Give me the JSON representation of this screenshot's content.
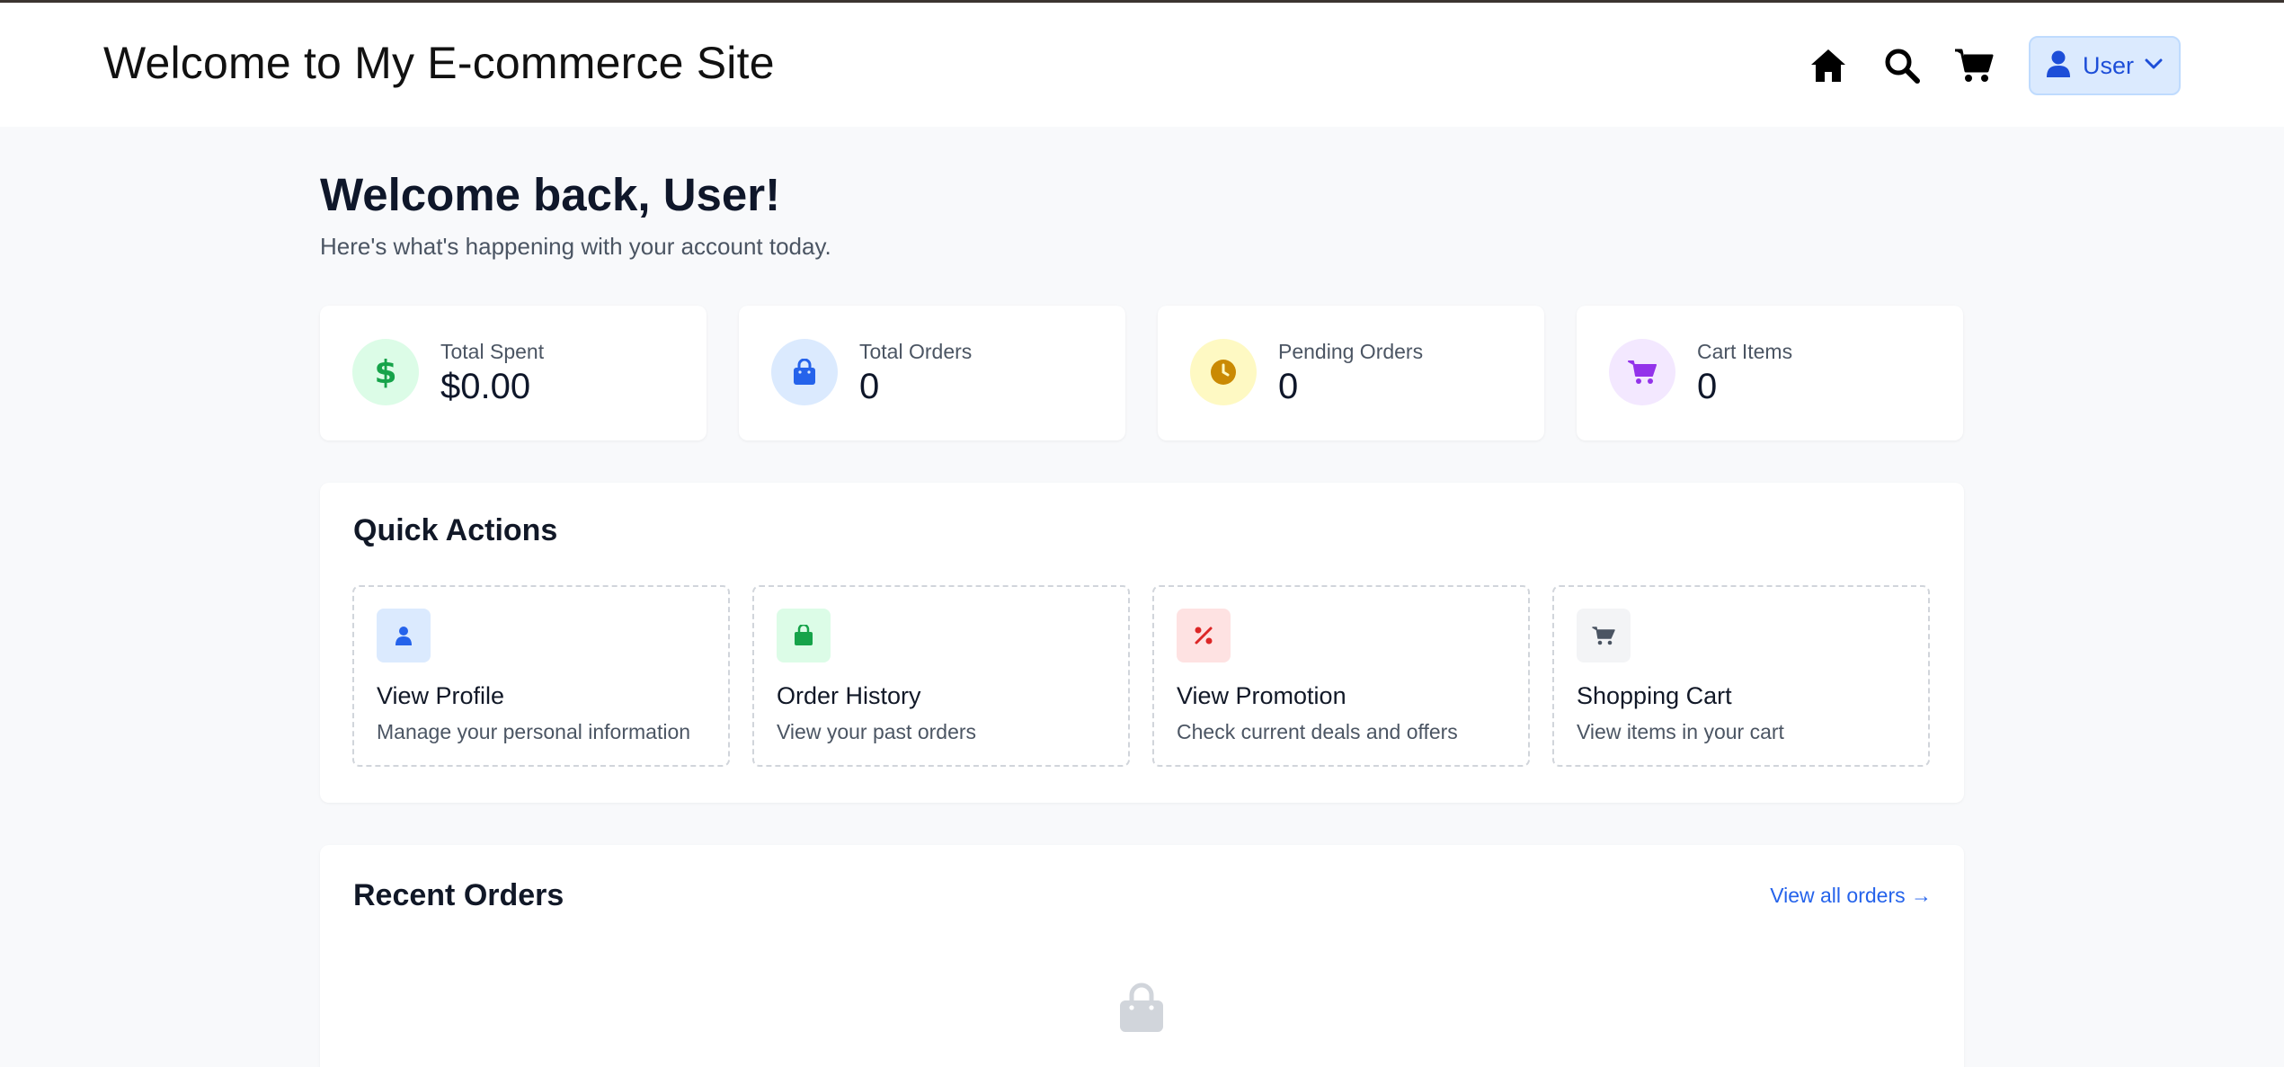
{
  "header": {
    "site_title": "Welcome to My E-commerce Site",
    "nav_icons": [
      "home-icon",
      "search-icon",
      "cart-icon"
    ],
    "user_menu": {
      "label": "User",
      "icons": [
        "user-icon",
        "chevron-down-icon"
      ]
    }
  },
  "dashboard": {
    "greeting": "Welcome back, User!",
    "subtitle": "Here's what's happening with your account today."
  },
  "stats": [
    {
      "label": "Total Spent",
      "value": "$0.00",
      "icon": "dollar-icon",
      "icon_bg": "#dcfce7",
      "icon_color": "#16a34a"
    },
    {
      "label": "Total Orders",
      "value": "0",
      "icon": "shopping-bag-icon",
      "icon_bg": "#dbeafe",
      "icon_color": "#2563eb"
    },
    {
      "label": "Pending Orders",
      "value": "0",
      "icon": "clock-icon",
      "icon_bg": "#fef9c3",
      "icon_color": "#ca8a04"
    },
    {
      "label": "Cart Items",
      "value": "0",
      "icon": "cart-icon",
      "icon_bg": "#f3e8ff",
      "icon_color": "#9333ea"
    }
  ],
  "quick_actions": {
    "title": "Quick Actions",
    "items": [
      {
        "title": "View Profile",
        "description": "Manage your personal information",
        "icon": "user-icon",
        "icon_bg": "#dbeafe",
        "icon_color": "#2563eb"
      },
      {
        "title": "Order History",
        "description": "View your past orders",
        "icon": "shopping-bag-icon",
        "icon_bg": "#dcfce7",
        "icon_color": "#16a34a"
      },
      {
        "title": "View Promotion",
        "description": "Check current deals and offers",
        "icon": "percent-icon",
        "icon_bg": "#fee2e2",
        "icon_color": "#dc2626"
      },
      {
        "title": "Shopping Cart",
        "description": "View items in your cart",
        "icon": "cart-icon",
        "icon_bg": "#f3f4f6",
        "icon_color": "#4b5563"
      }
    ]
  },
  "recent_orders": {
    "title": "Recent Orders",
    "view_all_label": "View all orders →",
    "empty_icon": "shopping-bag-icon"
  },
  "colors": {
    "accent": "#2563eb",
    "background": "#f8f9fb",
    "card": "#ffffff"
  }
}
